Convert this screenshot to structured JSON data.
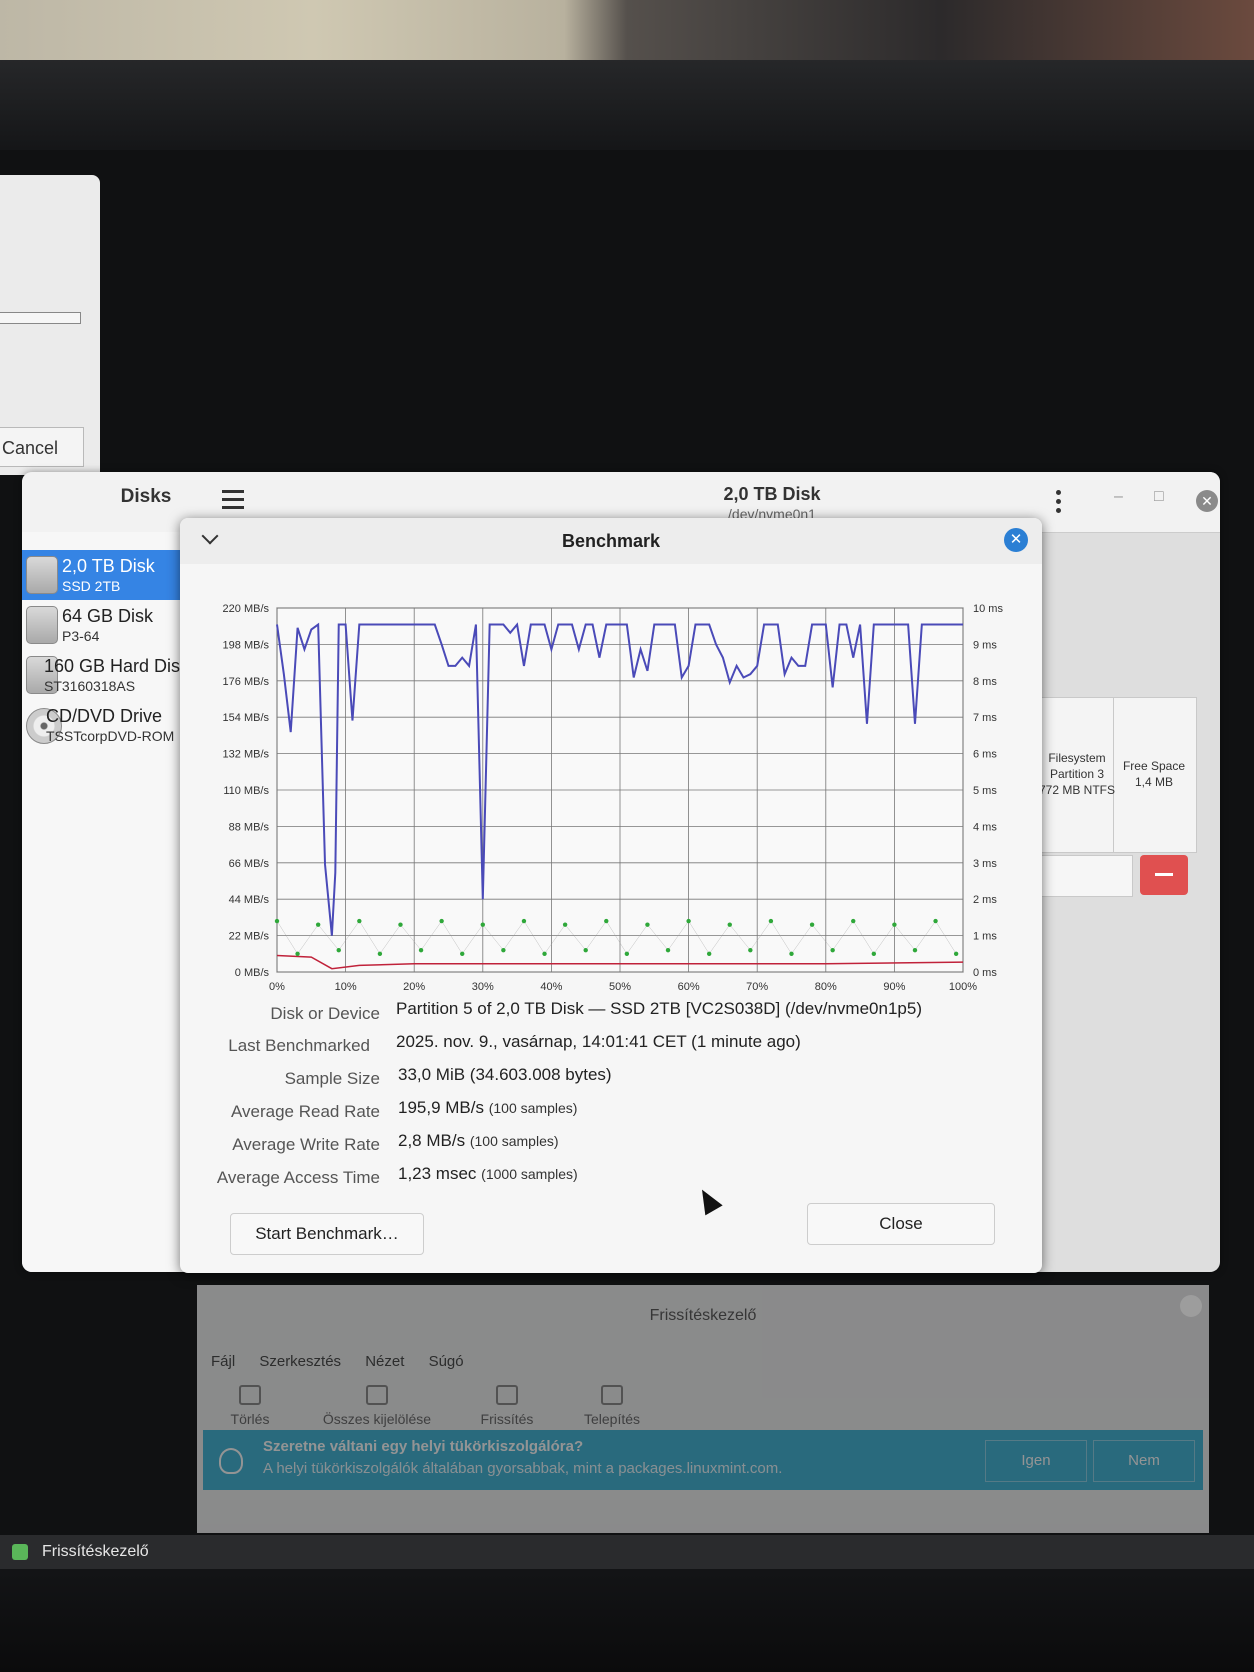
{
  "left_dialog": {
    "cancel_label": "Cancel"
  },
  "disks_window": {
    "app_title": "Disks",
    "disk_title": "2,0 TB Disk",
    "disk_subtitle": "/dev/nvme0n1",
    "drives": [
      {
        "name": "2,0 TB Disk",
        "model": "SSD 2TB",
        "selected": true
      },
      {
        "name": "64 GB Disk",
        "model": "P3-64",
        "selected": false
      },
      {
        "name": "160 GB Hard Disk",
        "model": "ST3160318AS",
        "selected": false
      },
      {
        "name": "CD/DVD Drive",
        "model": "TSSTcorpDVD-ROM",
        "selected": false
      }
    ],
    "partitions": [
      {
        "lines": [
          "Filesystem",
          "Partition 3",
          "772 MB NTFS"
        ]
      },
      {
        "lines": [
          "Free Space",
          "1,4 MB"
        ]
      }
    ]
  },
  "benchmark": {
    "title": "Benchmark",
    "fields": {
      "device_label": "Disk or Device",
      "device_value": "Partition 5 of 2,0 TB Disk — SSD 2TB [VC2S038D] (/dev/nvme0n1p5)",
      "last_label": "Last Benchmarked",
      "last_value": "2025. nov. 9., vasárnap, 14:01:41 CET (1 minute ago)",
      "sample_label": "Sample Size",
      "sample_value": "33,0 MiB (34.603.008 bytes)",
      "read_label": "Average Read Rate",
      "read_value": "195,9 MB/s",
      "read_samples": "(100 samples)",
      "write_label": "Average Write Rate",
      "write_value": "2,8 MB/s",
      "write_samples": "(100 samples)",
      "access_label": "Average Access Time",
      "access_value": "1,23 msec",
      "access_samples": "(1000 samples)"
    },
    "start_button": "Start Benchmark…",
    "close_button": "Close"
  },
  "chart_data": {
    "type": "line",
    "title": "",
    "xlabel": "",
    "ylabel": "",
    "x_ticks": [
      "0%",
      "10%",
      "20%",
      "30%",
      "40%",
      "50%",
      "60%",
      "70%",
      "80%",
      "90%",
      "100%"
    ],
    "y_left_ticks": [
      "0 MB/s",
      "22 MB/s",
      "44 MB/s",
      "66 MB/s",
      "88 MB/s",
      "110 MB/s",
      "132 MB/s",
      "154 MB/s",
      "176 MB/s",
      "198 MB/s",
      "220 MB/s"
    ],
    "y_right_ticks": [
      "0 ms",
      "1 ms",
      "2 ms",
      "3 ms",
      "4 ms",
      "5 ms",
      "6 ms",
      "7 ms",
      "8 ms",
      "9 ms",
      "10 ms"
    ],
    "xlim": [
      0,
      100
    ],
    "ylim_left": [
      0,
      220
    ],
    "ylim_right": [
      0,
      10
    ],
    "grid": true,
    "series": [
      {
        "color": "#4a4ab8",
        "axis": "left",
        "x": [
          0,
          1,
          2,
          3,
          4,
          5,
          6,
          7,
          8,
          8.5,
          9,
          10,
          11,
          12,
          13,
          14,
          15,
          16,
          17,
          18,
          19,
          20,
          21,
          22,
          23,
          24,
          25,
          26,
          27,
          28,
          29,
          30,
          31,
          32,
          33,
          34,
          35,
          36,
          37,
          38,
          39,
          40,
          41,
          42,
          43,
          44,
          45,
          46,
          47,
          48,
          49,
          50,
          51,
          52,
          53,
          54,
          55,
          56,
          57,
          58,
          59,
          60,
          61,
          62,
          63,
          64,
          65,
          66,
          67,
          68,
          69,
          70,
          71,
          72,
          73,
          74,
          75,
          76,
          77,
          78,
          79,
          80,
          81,
          82,
          83,
          84,
          85,
          86,
          87,
          88,
          89,
          90,
          91,
          92,
          93,
          94,
          95,
          96,
          97,
          98,
          99,
          100
        ],
        "values": [
          210,
          180,
          145,
          208,
          195,
          207,
          210,
          65,
          22,
          60,
          210,
          210,
          152,
          210,
          210,
          210,
          210,
          210,
          210,
          210,
          210,
          210,
          210,
          210,
          210,
          198,
          185,
          185,
          190,
          185,
          210,
          44,
          210,
          210,
          210,
          205,
          210,
          185,
          210,
          210,
          210,
          195,
          210,
          210,
          210,
          195,
          210,
          210,
          190,
          210,
          210,
          210,
          210,
          178,
          195,
          182,
          210,
          210,
          210,
          210,
          178,
          185,
          210,
          210,
          210,
          198,
          190,
          175,
          185,
          178,
          180,
          185,
          210,
          210,
          210,
          180,
          190,
          185,
          185,
          210,
          210,
          210,
          172,
          210,
          210,
          190,
          210,
          150,
          210,
          210,
          210,
          210,
          210,
          210,
          150,
          210,
          210,
          210,
          210,
          210,
          210,
          210
        ]
      },
      {
        "color": "#c0223a",
        "axis": "left",
        "x": [
          0,
          5,
          8,
          12,
          20,
          40,
          60,
          80,
          100
        ],
        "values": [
          10,
          9,
          2,
          4,
          5,
          5,
          5,
          5,
          6
        ]
      },
      {
        "color": "#2fa83a",
        "axis": "right",
        "style": "scatter",
        "x": [
          0,
          3,
          6,
          9,
          12,
          15,
          18,
          21,
          24,
          27,
          30,
          33,
          36,
          39,
          42,
          45,
          48,
          51,
          54,
          57,
          60,
          63,
          66,
          69,
          72,
          75,
          78,
          81,
          84,
          87,
          90,
          93,
          96,
          99
        ],
        "values": [
          1.4,
          0.5,
          1.3,
          0.6,
          1.4,
          0.5,
          1.3,
          0.6,
          1.4,
          0.5,
          1.3,
          0.6,
          1.4,
          0.5,
          1.3,
          0.6,
          1.4,
          0.5,
          1.3,
          0.6,
          1.4,
          0.5,
          1.3,
          0.6,
          1.4,
          0.5,
          1.3,
          0.6,
          1.4,
          0.5,
          1.3,
          0.6,
          1.4,
          0.5
        ]
      }
    ]
  },
  "update_manager": {
    "title": "Frissítéskezelő",
    "menu": [
      "Fájl",
      "Szerkesztés",
      "Nézet",
      "Súgó"
    ],
    "toolbar": [
      "Törlés",
      "Összes kijelölése",
      "Frissítés",
      "Telepítés"
    ],
    "banner_question": "Szeretne váltani egy helyi tükörkiszolgálóra?",
    "banner_detail": "A helyi tükörkiszolgálók általában gyorsabbak, mint a packages.linuxmint.com.",
    "yes_label": "Igen",
    "no_label": "Nem"
  },
  "taskbar": {
    "item_label": "Frissítéskezelő"
  }
}
